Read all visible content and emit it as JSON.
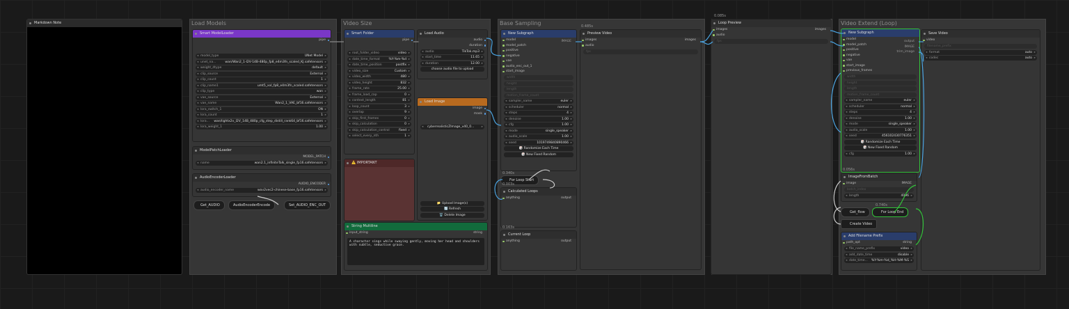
{
  "canvas": {
    "background": "#1a1a1a"
  },
  "markdown_note": {
    "title": "Markdown Note"
  },
  "groups": {
    "load_models": "Load Models",
    "video_size": "Video Size",
    "base_sampling": "Base Sampling",
    "loop_preview_group": "",
    "video_extend": "Video Extend (Loop)"
  },
  "smart_model_loader": {
    "title": "Smart ModelLoader",
    "output": "pipe",
    "widgets": [
      {
        "k": "model_type",
        "v": "UNet Model"
      },
      {
        "k": "unet_na...",
        "v": "wan/Wan2_1-I2V-14B-480p_fp8_e4m3fn_scaled_KJ.safetensors"
      },
      {
        "k": "weight_dtype",
        "v": "default"
      },
      {
        "k": "clip_source",
        "v": "External"
      },
      {
        "k": "clip_count",
        "v": "1"
      },
      {
        "k": "clip_name1",
        "v": "umt5_xxl_fp8_e4m3fn_scaled.safetensors"
      },
      {
        "k": "clip_type",
        "v": "wan"
      },
      {
        "k": "vae_source",
        "v": "External"
      },
      {
        "k": "vae_name",
        "v": "Wan2_1_VAE_bf16.safetensors"
      },
      {
        "k": "lora_switch_1",
        "v": "ON"
      },
      {
        "k": "lora_count",
        "v": "1"
      },
      {
        "k": "lora...",
        "v": "wan/lightx2v_I2V_14B_480p_cfg_step_distill_rank64_bf16.safetensors"
      },
      {
        "k": "lora_weight_1",
        "v": "1.00"
      }
    ]
  },
  "model_patch_loader": {
    "title": "ModelPatchLoader",
    "output": "MODEL_PATCH",
    "widget_k": "name",
    "widget_v": "wan2.1_infiniteTalk_single_fp16.safetensors"
  },
  "audio_encoder_loader": {
    "title": "AudioEncoderLoader",
    "output": "AUDIO_ENCODER",
    "widget_k": "audio_encoder_name",
    "widget_v": "wav2vec2-chinese-base_fp16.safetensors"
  },
  "bottom_pills": {
    "get_audio": "Get_AUDIO",
    "audio_encoder_encode": "AudioEncoderEncode",
    "set_audio_enc": "Set_AUDIO_ENC_OUT"
  },
  "smart_folder": {
    "title": "Smart Folder",
    "output": "pipe",
    "widgets": [
      {
        "k": "root_folder_video",
        "v": "video"
      },
      {
        "k": "date_time_format",
        "v": "%Y-%m-%d"
      },
      {
        "k": "date_time_position",
        "v": "postfix"
      },
      {
        "k": "video_size",
        "v": "Custom"
      },
      {
        "k": "video_width",
        "v": "480"
      },
      {
        "k": "video_height",
        "v": "832"
      },
      {
        "k": "frame_rate",
        "v": "25.00"
      },
      {
        "k": "frame_load_cap",
        "v": "0"
      },
      {
        "k": "context_length",
        "v": "81"
      },
      {
        "k": "loop_count",
        "v": "3"
      },
      {
        "k": "overlap",
        "v": "9"
      },
      {
        "k": "skip_first_frames",
        "v": "0"
      },
      {
        "k": "skip_calculation",
        "v": "0"
      },
      {
        "k": "skip_calculation_control",
        "v": "fixed"
      },
      {
        "k": "select_every_nth",
        "v": "1"
      }
    ]
  },
  "load_audio": {
    "title": "Load Audio",
    "outputs": [
      "audio",
      "duration"
    ],
    "widgets": [
      {
        "k": "audio",
        "v": "TikTok.mp3"
      },
      {
        "k": "start_time",
        "v": "11.65"
      },
      {
        "k": "duration",
        "v": "12.00"
      }
    ],
    "button": "choose audio file to upload"
  },
  "load_image": {
    "title": "Load Image",
    "outputs": [
      "image",
      "mask"
    ],
    "widget_v": "cyberrealisticZImage_v40_0...",
    "buttons": [
      "Upload Image(s)",
      "Refresh",
      "Delete Image"
    ]
  },
  "important": {
    "title": "⚠️ IMPORTANT"
  },
  "string_multiline": {
    "title": "String Multiline",
    "input": "input_string",
    "output": "string",
    "text": "A character sings while swaying gently, moving her head and shoulders with subtle, seductive grace."
  },
  "subgraph1": {
    "title": "New Subgraph",
    "inputs": [
      "model",
      "model_patch",
      "positive",
      "negative",
      "vae",
      "audio_enc_out_1",
      "start_image"
    ],
    "output": "IMAGE",
    "ghost": [
      "width",
      "height",
      "length",
      "motion_frame_count"
    ],
    "widgets": [
      {
        "k": "sampler_name",
        "v": "euler"
      },
      {
        "k": "scheduler",
        "v": "normal"
      },
      {
        "k": "steps",
        "v": "4"
      },
      {
        "k": "denoise",
        "v": "1.00"
      },
      {
        "k": "cfg",
        "v": "1.00"
      },
      {
        "k": "mode",
        "v": "single_speaker"
      },
      {
        "k": "audio_scale",
        "v": "1.00"
      },
      {
        "k": "seed",
        "v": "1019749840890466"
      }
    ],
    "buttons": [
      "Randomize Each Time",
      "New Fixed Random"
    ]
  },
  "preview_video": {
    "title": "Preview Video",
    "badge": "0.485s",
    "inputs": [
      "images",
      "audio",
      "fps"
    ],
    "output": "images"
  },
  "for_loop_start": {
    "title": "For Loop Start",
    "badge": "0.340s",
    "badge2": "0.003s"
  },
  "calculated_loops": {
    "title": "Calculated Loops",
    "input": "anything",
    "output": "output"
  },
  "current_loop": {
    "title": "Current Loop",
    "badge": "0.163s",
    "input": "anything",
    "output": "output"
  },
  "loop_preview": {
    "title": "Loop Preview",
    "badge": "0.085s",
    "inputs": [
      "images",
      "audio",
      "fps"
    ],
    "output": "images"
  },
  "subgraph2": {
    "title": "New Subgraph",
    "inputs": [
      "model",
      "model_patch",
      "positive",
      "negative",
      "vae",
      "start_image",
      "previous_frames"
    ],
    "outputs": [
      "output",
      "IMAGE",
      "trim_image"
    ],
    "ghost": [
      "width",
      "height",
      "length",
      "motion_frame_count"
    ],
    "widgets": [
      {
        "k": "sampler_name",
        "v": "euler"
      },
      {
        "k": "scheduler",
        "v": "normal"
      },
      {
        "k": "steps",
        "v": "4"
      },
      {
        "k": "denoise",
        "v": "1.00"
      },
      {
        "k": "mode",
        "v": "single_speaker"
      },
      {
        "k": "audio_scale",
        "v": "1.00"
      },
      {
        "k": "seed",
        "v": "456102430776351"
      }
    ],
    "buttons": [
      "Randomize Each Time",
      "New Fixed Random"
    ],
    "cfg_k": "cfg",
    "cfg_v": "1.00"
  },
  "save_video": {
    "title": "Save Video",
    "input": "video",
    "placeholder": "filename_prefix",
    "widgets": [
      {
        "k": "format",
        "v": "auto"
      },
      {
        "k": "codec",
        "v": "auto"
      }
    ]
  },
  "image_from_batch": {
    "title": "ImageFromBatch",
    "badge": "0.056s",
    "input": "image",
    "ghost": "batch_index",
    "output": "IMAGE",
    "widget_k": "length",
    "widget_v": "4096"
  },
  "get_flow": {
    "title": "Get_flow"
  },
  "for_loop_end": {
    "title": "For Loop End",
    "badge": "0.740s"
  },
  "create_video": {
    "title": "Create Video"
  },
  "filename_prefix": {
    "title": "Add Filename Prefix",
    "input": "path_opt",
    "output": "string",
    "widgets": [
      {
        "k": "file_name_prefix",
        "v": "video"
      },
      {
        "k": "add_date_time",
        "v": "disable"
      },
      {
        "k": "date_time...",
        "v": "%Y-%m-%d_%H-%M-%S"
      }
    ]
  }
}
